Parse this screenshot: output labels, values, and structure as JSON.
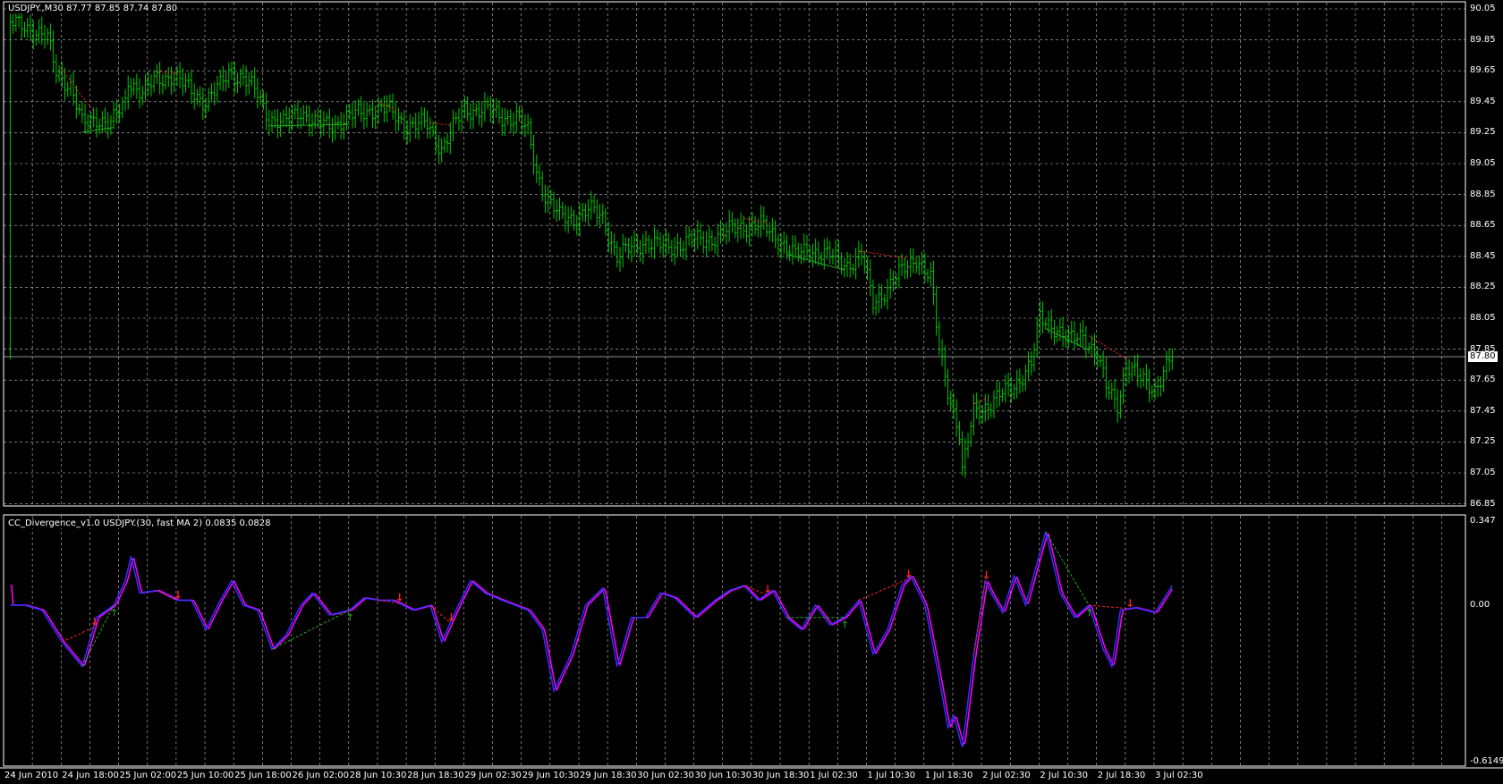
{
  "main": {
    "title": "USDJPY.,M30  87.77 87.85 87.74 87.80",
    "current_price": "87.80",
    "price_axis": [
      "90.05",
      "89.85",
      "89.65",
      "89.45",
      "89.25",
      "89.05",
      "88.85",
      "88.65",
      "88.45",
      "88.25",
      "88.05",
      "87.85",
      "87.65",
      "87.45",
      "87.25",
      "87.05",
      "86.85"
    ]
  },
  "indicator": {
    "title": "CC_Divergence_v1.0 USDJPY.(30, fast MA 2) 0.0835 0.0828",
    "axis": [
      "0.347",
      "0.00",
      "-0.6149"
    ]
  },
  "time_axis": [
    "24 Jun 2010",
    "24 Jun 18:00",
    "25 Jun 02:00",
    "25 Jun 10:00",
    "25 Jun 18:00",
    "26 Jun 02:00",
    "28 Jun 10:30",
    "28 Jun 18:30",
    "29 Jun 02:30",
    "29 Jun 10:30",
    "29 Jun 18:30",
    "30 Jun 02:30",
    "30 Jun 10:30",
    "30 Jun 18:30",
    "1 Jul 02:30",
    "1 Jul 10:30",
    "1 Jul 18:30",
    "2 Jul 02:30",
    "2 Jul 10:30",
    "2 Jul 18:30",
    "3 Jul 02:30"
  ],
  "colors": {
    "bars": "#00c800",
    "osc": "#3030ff",
    "signal": "#ff00ff",
    "bear": "#ff2020",
    "bull": "#20b020",
    "grid": "#c0c0c0"
  },
  "chart_data": {
    "type": "line",
    "price_range": [
      86.85,
      90.05
    ],
    "osc_range": [
      -0.6149,
      0.347
    ],
    "price_path": [
      [
        2,
        89.95
      ],
      [
        7,
        89.95
      ],
      [
        15,
        89.85
      ],
      [
        18,
        89.65
      ],
      [
        23,
        89.55
      ],
      [
        27,
        89.3
      ],
      [
        32,
        89.35
      ],
      [
        37,
        89.3
      ],
      [
        42,
        89.45
      ],
      [
        43,
        89.6
      ],
      [
        48,
        89.5
      ],
      [
        53,
        89.6
      ],
      [
        58,
        89.62
      ],
      [
        63,
        89.55
      ],
      [
        70,
        89.45
      ],
      [
        75,
        89.55
      ],
      [
        78,
        89.65
      ],
      [
        83,
        89.6
      ],
      [
        88,
        89.5
      ],
      [
        92,
        89.35
      ],
      [
        97,
        89.3
      ],
      [
        103,
        89.4
      ],
      [
        108,
        89.3
      ],
      [
        113,
        89.3
      ],
      [
        120,
        89.35
      ],
      [
        127,
        89.4
      ],
      [
        133,
        89.4
      ],
      [
        140,
        89.3
      ],
      [
        147,
        89.3
      ],
      [
        152,
        89.15
      ],
      [
        155,
        89.25
      ],
      [
        160,
        89.4
      ],
      [
        167,
        89.4
      ],
      [
        173,
        89.35
      ],
      [
        178,
        89.35
      ],
      [
        182,
        89.25
      ],
      [
        185,
        89.0
      ],
      [
        188,
        88.85
      ],
      [
        193,
        88.7
      ],
      [
        198,
        88.7
      ],
      [
        203,
        88.75
      ],
      [
        208,
        88.7
      ],
      [
        213,
        88.45
      ],
      [
        218,
        88.5
      ],
      [
        223,
        88.55
      ],
      [
        230,
        88.5
      ],
      [
        237,
        88.55
      ],
      [
        243,
        88.55
      ],
      [
        250,
        88.6
      ],
      [
        257,
        88.65
      ],
      [
        263,
        88.65
      ],
      [
        270,
        88.55
      ],
      [
        275,
        88.45
      ],
      [
        280,
        88.5
      ],
      [
        287,
        88.45
      ],
      [
        293,
        88.4
      ],
      [
        298,
        88.45
      ],
      [
        302,
        88.15
      ],
      [
        307,
        88.25
      ],
      [
        312,
        88.35
      ],
      [
        317,
        88.45
      ],
      [
        322,
        88.3
      ],
      [
        325,
        87.85
      ],
      [
        328,
        87.6
      ],
      [
        332,
        87.3
      ],
      [
        333,
        87.05
      ],
      [
        337,
        87.45
      ],
      [
        343,
        87.5
      ],
      [
        350,
        87.6
      ],
      [
        357,
        87.75
      ],
      [
        360,
        88.05
      ],
      [
        365,
        88.0
      ],
      [
        370,
        87.9
      ],
      [
        375,
        87.95
      ],
      [
        380,
        87.8
      ],
      [
        383,
        87.6
      ],
      [
        387,
        87.5
      ],
      [
        390,
        87.75
      ],
      [
        395,
        87.65
      ],
      [
        400,
        87.6
      ],
      [
        403,
        87.7
      ],
      [
        406,
        87.8
      ]
    ],
    "osc_path": [
      [
        2,
        0
      ],
      [
        7,
        0
      ],
      [
        13,
        -0.02
      ],
      [
        20,
        -0.15
      ],
      [
        27,
        -0.25
      ],
      [
        32,
        -0.05
      ],
      [
        38,
        0
      ],
      [
        42,
        0.1
      ],
      [
        44,
        0.2
      ],
      [
        47,
        0.05
      ],
      [
        53,
        0.06
      ],
      [
        60,
        0.02
      ],
      [
        65,
        0.02
      ],
      [
        70,
        -0.1
      ],
      [
        75,
        0.02
      ],
      [
        79,
        0.1
      ],
      [
        83,
        0
      ],
      [
        88,
        -0.02
      ],
      [
        93,
        -0.18
      ],
      [
        98,
        -0.12
      ],
      [
        103,
        0
      ],
      [
        107,
        0.05
      ],
      [
        113,
        -0.04
      ],
      [
        120,
        -0.02
      ],
      [
        125,
        0.03
      ],
      [
        130,
        0.02
      ],
      [
        135,
        0.02
      ],
      [
        142,
        -0.02
      ],
      [
        148,
        0
      ],
      [
        152,
        -0.15
      ],
      [
        157,
        -0.02
      ],
      [
        162,
        0.1
      ],
      [
        167,
        0.05
      ],
      [
        173,
        0.02
      ],
      [
        182,
        -0.02
      ],
      [
        187,
        -0.1
      ],
      [
        191,
        -0.35
      ],
      [
        197,
        -0.2
      ],
      [
        202,
        0
      ],
      [
        208,
        0.07
      ],
      [
        213,
        -0.25
      ],
      [
        218,
        -0.05
      ],
      [
        223,
        -0.05
      ],
      [
        228,
        0.05
      ],
      [
        233,
        0.03
      ],
      [
        240,
        -0.05
      ],
      [
        247,
        0.02
      ],
      [
        252,
        0.06
      ],
      [
        257,
        0.08
      ],
      [
        262,
        0.02
      ],
      [
        267,
        0.06
      ],
      [
        272,
        -0.05
      ],
      [
        277,
        -0.1
      ],
      [
        282,
        0
      ],
      [
        287,
        -0.08
      ],
      [
        292,
        -0.05
      ],
      [
        297,
        0.02
      ],
      [
        302,
        -0.2
      ],
      [
        307,
        -0.1
      ],
      [
        312,
        0.08
      ],
      [
        315,
        0.12
      ],
      [
        320,
        0
      ],
      [
        325,
        -0.3
      ],
      [
        328,
        -0.5
      ],
      [
        330,
        -0.45
      ],
      [
        333,
        -0.58
      ],
      [
        337,
        -0.2
      ],
      [
        341,
        0.1
      ],
      [
        343,
        0.05
      ],
      [
        347,
        -0.03
      ],
      [
        351,
        0.12
      ],
      [
        355,
        0
      ],
      [
        362,
        0.3
      ],
      [
        367,
        0.05
      ],
      [
        372,
        -0.05
      ],
      [
        377,
        0
      ],
      [
        382,
        -0.18
      ],
      [
        385,
        -0.25
      ],
      [
        388,
        -0.02
      ],
      [
        393,
        -0.01
      ],
      [
        400,
        -0.03
      ],
      [
        406,
        0.08
      ]
    ],
    "bearish_divergences": [
      [
        20,
        31
      ],
      [
        53,
        60
      ],
      [
        130,
        137
      ],
      [
        148,
        155
      ],
      [
        257,
        265
      ],
      [
        297,
        314
      ],
      [
        337,
        341
      ],
      [
        377,
        391
      ]
    ],
    "bullish_divergences": [
      [
        27,
        38
      ],
      [
        93,
        120
      ],
      [
        272,
        292
      ],
      [
        362,
        377
      ]
    ]
  }
}
